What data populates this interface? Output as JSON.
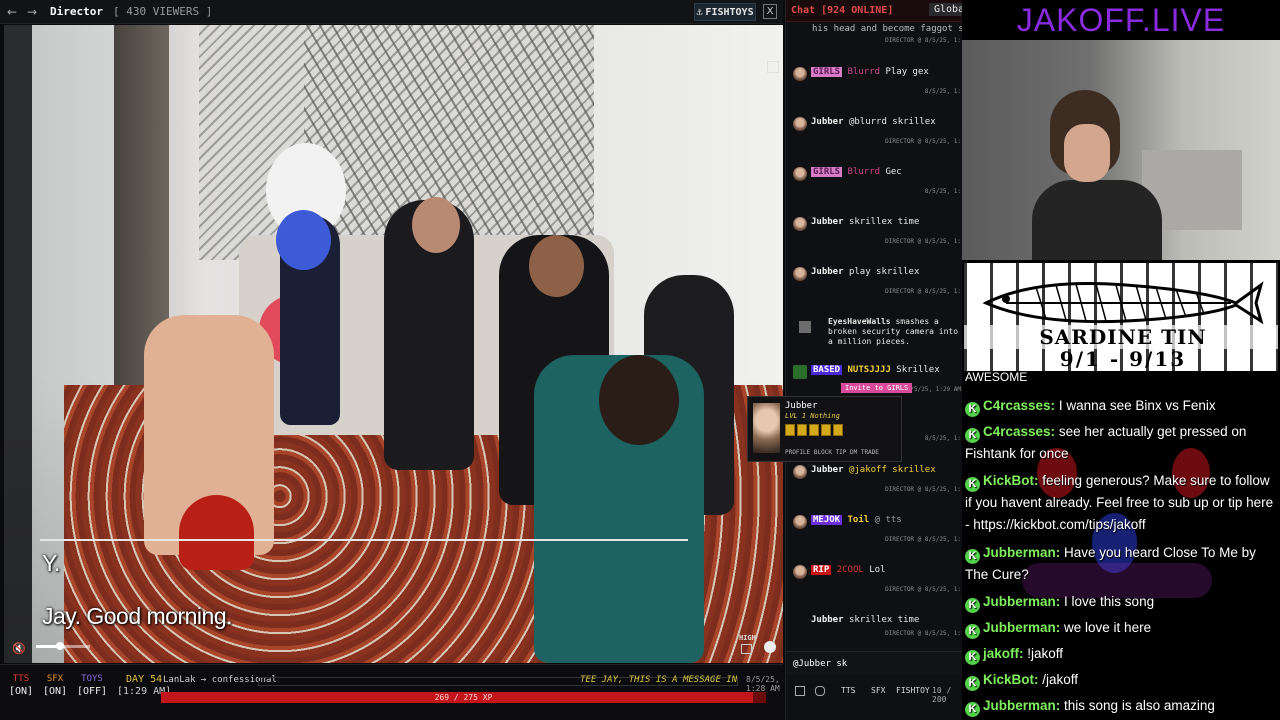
{
  "topbar": {
    "room_title": "Director",
    "viewers": "[ 430 VIEWERS ]",
    "fishtoys_label": "FISHTOYS",
    "close_label": "X"
  },
  "video": {
    "captions": [
      "Y.",
      "Jay. Good morning."
    ],
    "quality": "HIGH",
    "volume_fraction": 0.45
  },
  "toggles": [
    {
      "label": "TTS",
      "state": "[ON]",
      "color": "#e23a3a"
    },
    {
      "label": "SFX",
      "state": "[ON]",
      "color": "#e6922a"
    },
    {
      "label": "TOYS",
      "state": "[OFF]",
      "color": "#8b6ad8"
    }
  ],
  "day": {
    "label": "DAY 54",
    "time": "[1:29 AM]"
  },
  "feed": {
    "text": "LanLak → confessional",
    "marquee": "TEE JAY, THIS IS A MESSAGE IN EN",
    "time": "8/5/25, 1:28 AM"
  },
  "xp": {
    "text": "269 / 275 XP",
    "current": 269,
    "max": 275
  },
  "chat": {
    "title": "Chat [924 ONLINE]",
    "tab": "Global",
    "top_fragment": "his head and become faggot skrille",
    "messages": [
      {
        "tag": "",
        "user": "",
        "text": "",
        "meta": "DIRECTOR @ 8/5/25, 1:"
      },
      {
        "tag": "GIRLS",
        "user": "Blurrd",
        "text": "Play gex",
        "meta": "8/5/25, 1:"
      },
      {
        "tag": "",
        "user": "Jubber",
        "text": "@blurrd skrillex",
        "meta": "DIRECTOR @ 8/5/25, 1:"
      },
      {
        "tag": "GIRLS",
        "user": "Blurrd",
        "text": "Gec",
        "meta": "8/5/25, 1:"
      },
      {
        "tag": "",
        "user": "Jubber",
        "text": "skrillex time",
        "meta": "DIRECTOR @ 8/5/25, 1:"
      },
      {
        "tag": "",
        "user": "Jubber",
        "text": "play skrillex",
        "meta": "DIRECTOR @ 8/5/25, 1:"
      },
      {
        "tag": "BASED",
        "user": "NUTSJJJJ",
        "text": "Skrillex",
        "meta": "8/5/25, 1:29 AM"
      },
      {
        "tag": "",
        "user": "",
        "text": "",
        "meta": "8/5/25, 1:"
      },
      {
        "tag": "",
        "user": "Jubber",
        "text": "@jakoff skrillex",
        "meta": "DIRECTOR @ 8/5/25, 1:"
      },
      {
        "tag": "MEJOK",
        "user": "Toil",
        "text": "@ tts",
        "meta": "DIRECTOR @ 8/5/25, 1:"
      },
      {
        "tag": "RIP",
        "user": "2COOL",
        "text": "Lol",
        "meta": "DIRECTOR @ 8/5/25, 1:"
      },
      {
        "tag": "",
        "user": "Jubber",
        "text": "skrillex time",
        "meta": "DIRECTOR @ 8/5/25, 1:"
      }
    ],
    "event": {
      "user": "EyesHaveWalls",
      "text": "smashes a broken security camera into a million pieces."
    },
    "invite_label": "Invite to GIRLS",
    "input_value": "@Jubber sk",
    "tools": {
      "tts": "TTS",
      "sfx": "SFX",
      "fishtoy": "FISHTOY",
      "count": "10 / 200"
    }
  },
  "profile_card": {
    "name": "Jubber",
    "level": "LVL 1 Nothing",
    "actions": "PROFILE  BLOCK  TIP  DM  TRADE"
  },
  "right_stream": {
    "brand": "JAKOFF.LIVE",
    "sardine_title": "SARDINE TIN",
    "sardine_dates": "9/1 - 9/13",
    "top_fragment": "AWESOME",
    "lines": [
      {
        "name": "C4rcasses:",
        "text": "I wanna see Binx vs Fenix"
      },
      {
        "name": "C4rcasses:",
        "text": "see her actually get pressed on Fishtank for once"
      },
      {
        "name": "KickBot:",
        "text": "feeling generous? Make sure to follow if you havent already. Feel free to sub up or tip here - https://kickbot.com/tips/jakoff"
      },
      {
        "name": "Jubberman:",
        "text": "Have you heard Close To Me by The Cure?"
      },
      {
        "name": "Jubberman:",
        "text": "I love this song"
      },
      {
        "name": "Jubberman:",
        "text": "we love it here"
      },
      {
        "name": "jakoff:",
        "text": "!jakoff"
      },
      {
        "name": "KickBot:",
        "text": "/jakoff"
      },
      {
        "name": "Jubberman:",
        "text": "this song is also amazing"
      }
    ]
  },
  "colors": {
    "accent_red": "#c4151b",
    "kick_green": "#53d24a",
    "brand_purple": "#8a2be2"
  }
}
